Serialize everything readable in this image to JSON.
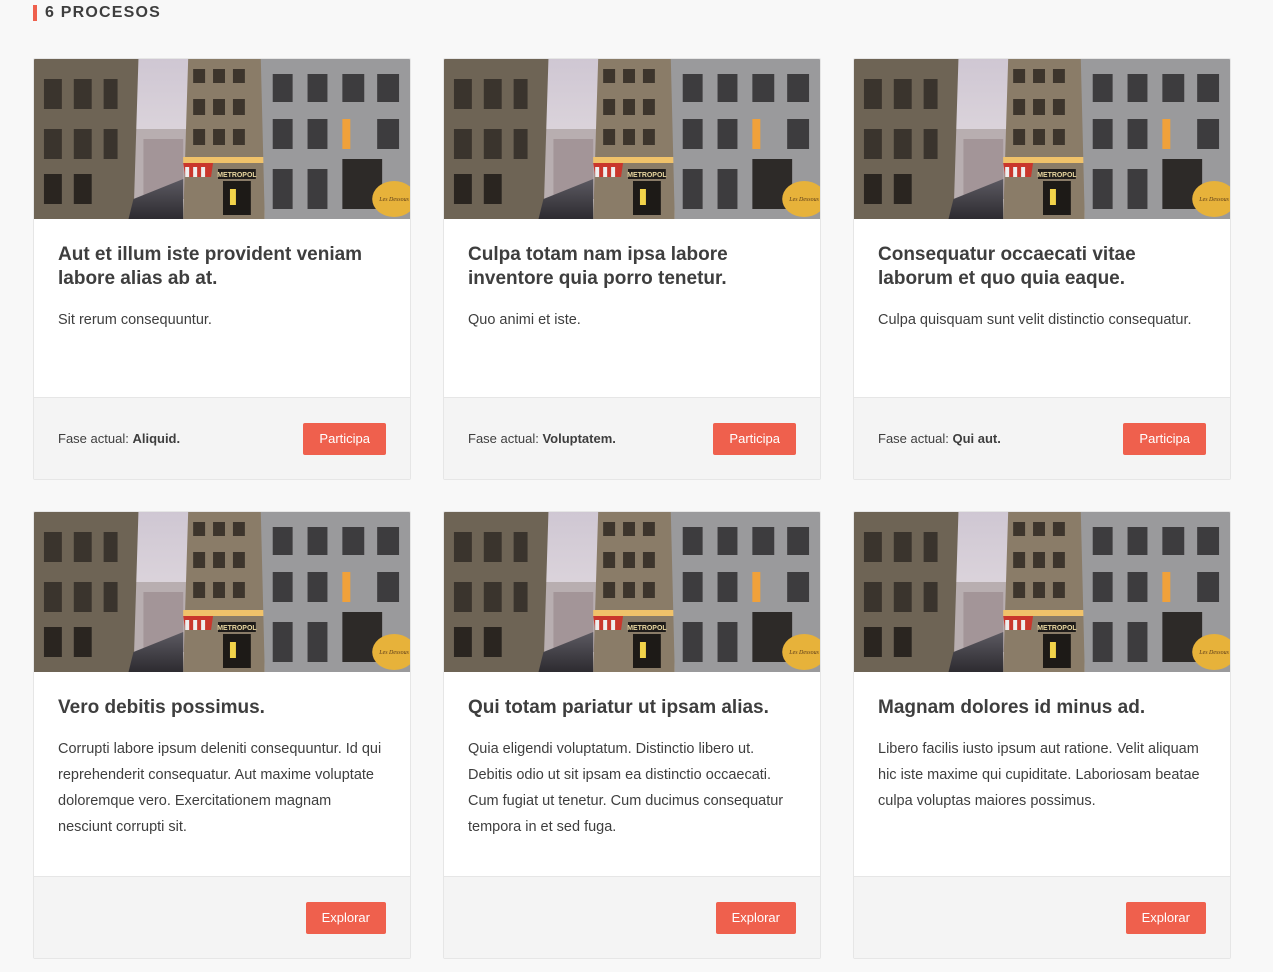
{
  "header": {
    "title": "6 PROCESOS"
  },
  "cards": [
    {
      "title": "Aut et illum iste provident veniam labore alias ab at.",
      "description": "Sit rerum consequuntur.",
      "phase_label": "Fase actual:",
      "phase_value": "Aliquid.",
      "button": "Participa"
    },
    {
      "title": "Culpa totam nam ipsa labore inventore quia porro tenetur.",
      "description": "Quo animi et iste.",
      "phase_label": "Fase actual:",
      "phase_value": "Voluptatem.",
      "button": "Participa"
    },
    {
      "title": "Consequatur occaecati vitae laborum et quo quia eaque.",
      "description": "Culpa quisquam sunt velit distinctio consequatur.",
      "phase_label": "Fase actual:",
      "phase_value": "Qui aut.",
      "button": "Participa"
    },
    {
      "title": "Vero debitis possimus.",
      "description": "Corrupti labore ipsum deleniti consequuntur. Id qui reprehenderit consequatur. Aut maxime voluptate doloremque vero. Exercitationem magnam nesciunt corrupti sit.",
      "button": "Explorar"
    },
    {
      "title": "Qui totam pariatur ut ipsam alias.",
      "description": "Quia eligendi voluptatum. Distinctio libero ut. Debitis odio ut sit ipsam ea distinctio occaecati. Cum fugiat ut tenetur. Cum ducimus consequatur tempora in et sed fuga.",
      "button": "Explorar"
    },
    {
      "title": "Magnam dolores id minus ad.",
      "description": "Libero facilis iusto ipsum aut ratione. Velit aliquam hic iste maxime qui cupiditate. Laboriosam beatae culpa voluptas maiores possimus.",
      "button": "Explorar"
    }
  ],
  "colors": {
    "accent": "#ef604d",
    "footer_bg": "#f4f4f4",
    "page_bg": "#f8f8f8"
  },
  "icons": {
    "card_image": "street-photo-image"
  }
}
